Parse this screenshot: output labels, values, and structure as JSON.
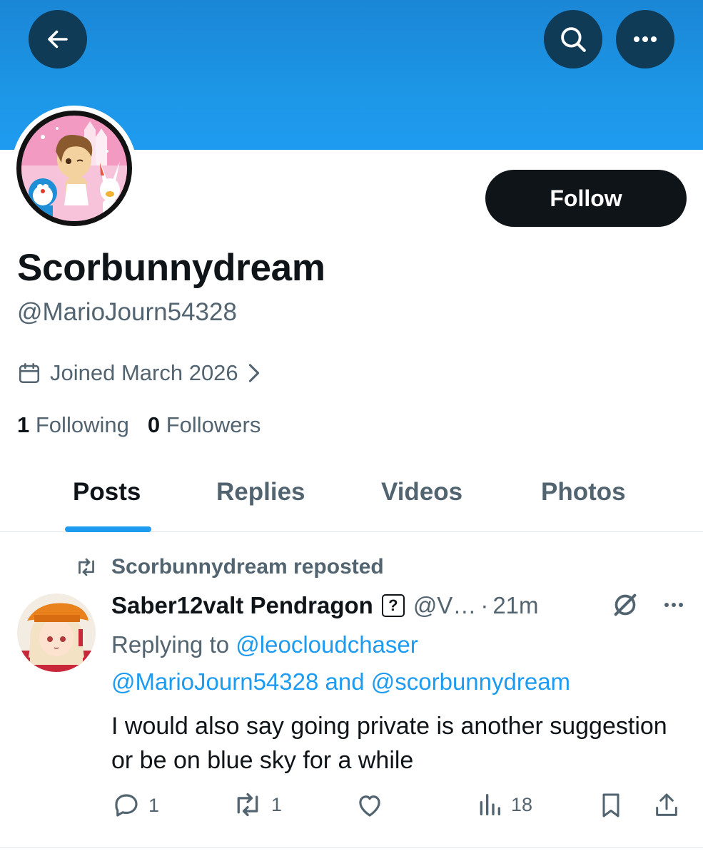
{
  "profile": {
    "display_name": "Scorbunnydream",
    "handle": "@MarioJourn54328",
    "joined": "Joined March 2026",
    "follow_label": "Follow",
    "following_count": "1",
    "following_label": "Following",
    "followers_count": "0",
    "followers_label": "Followers"
  },
  "tabs": [
    {
      "label": "Posts",
      "active": true
    },
    {
      "label": "Replies",
      "active": false
    },
    {
      "label": "Videos",
      "active": false
    },
    {
      "label": "Photos",
      "active": false
    }
  ],
  "post": {
    "repost_text": "Scorbunnydream reposted",
    "author_name": "Saber12valt Pendragon",
    "badge": "?",
    "author_handle": "@V…",
    "separator": "·",
    "time": "21m",
    "replying_prefix": "Replying to",
    "replying_user1": "@leocloudchaser",
    "replying_user2": "@MarioJourn54328",
    "replying_and": "and",
    "replying_user3": "@scorbunnydream",
    "text": "I would also say going private is another suggestion or be on blue sky for a while",
    "reply_count": "1",
    "repost_count": "1",
    "views_count": "18"
  },
  "icons": {
    "back": "arrow-left-icon",
    "search": "search-icon",
    "more": "more-icon",
    "calendar": "calendar-icon",
    "chevron": "chevron-right-icon",
    "repost": "repost-icon",
    "grok": "grok-icon",
    "reply": "reply-icon",
    "like": "heart-icon",
    "views": "views-icon",
    "bookmark": "bookmark-icon",
    "share": "share-icon"
  },
  "colors": {
    "banner": "#1d96e6",
    "link": "#1d9bf0",
    "primary_text": "#0f1419",
    "secondary_text": "#536471",
    "follow_button": "#0f1419"
  }
}
